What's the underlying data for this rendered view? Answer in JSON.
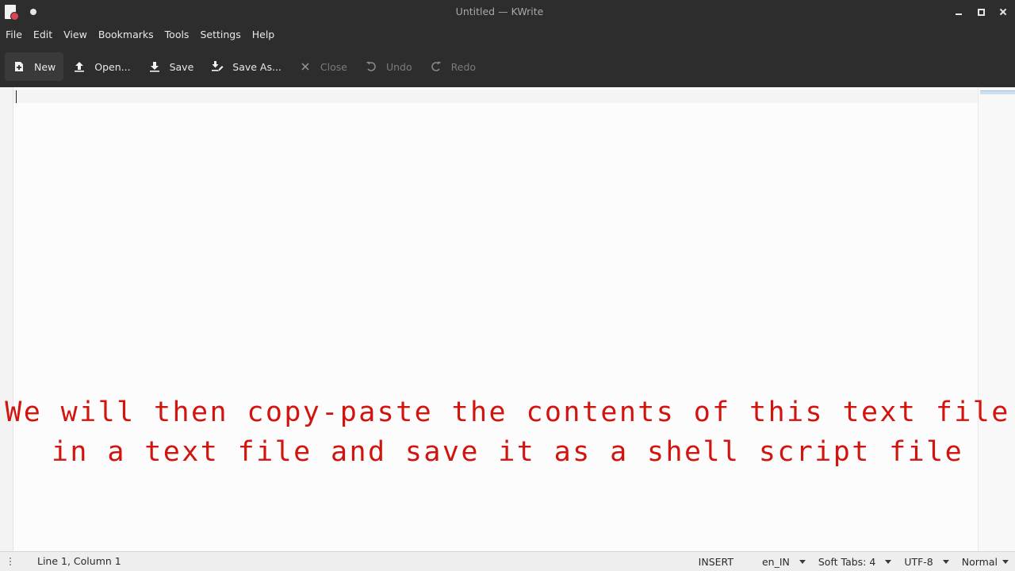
{
  "window": {
    "title": "Untitled — KWrite"
  },
  "menu": [
    "File",
    "Edit",
    "View",
    "Bookmarks",
    "Tools",
    "Settings",
    "Help"
  ],
  "toolbar": {
    "new_label": "New",
    "open_label": "Open...",
    "save_label": "Save",
    "save_as_label": "Save As...",
    "close_label": "Close",
    "undo_label": "Undo",
    "redo_label": "Redo"
  },
  "editor": {
    "content": "",
    "caption_line1": "We will then copy-paste the contents of this text file",
    "caption_line2": "in a text file and save it as a shell script file"
  },
  "statusbar": {
    "position": "Line 1, Column 1",
    "mode": "INSERT",
    "language": "en_IN",
    "indent": "Soft Tabs: 4",
    "encoding": "UTF-8",
    "highlight": "Normal"
  },
  "colors": {
    "chrome": "#2d2d2d",
    "caption": "#d2140f",
    "editor_bg": "#fcfcfc"
  },
  "icons": {
    "new": "document-new-icon",
    "open": "upload-arrow-icon",
    "save": "download-arrow-icon",
    "save_as": "save-as-icon",
    "close": "close-x-icon",
    "undo": "undo-icon",
    "redo": "redo-icon"
  }
}
